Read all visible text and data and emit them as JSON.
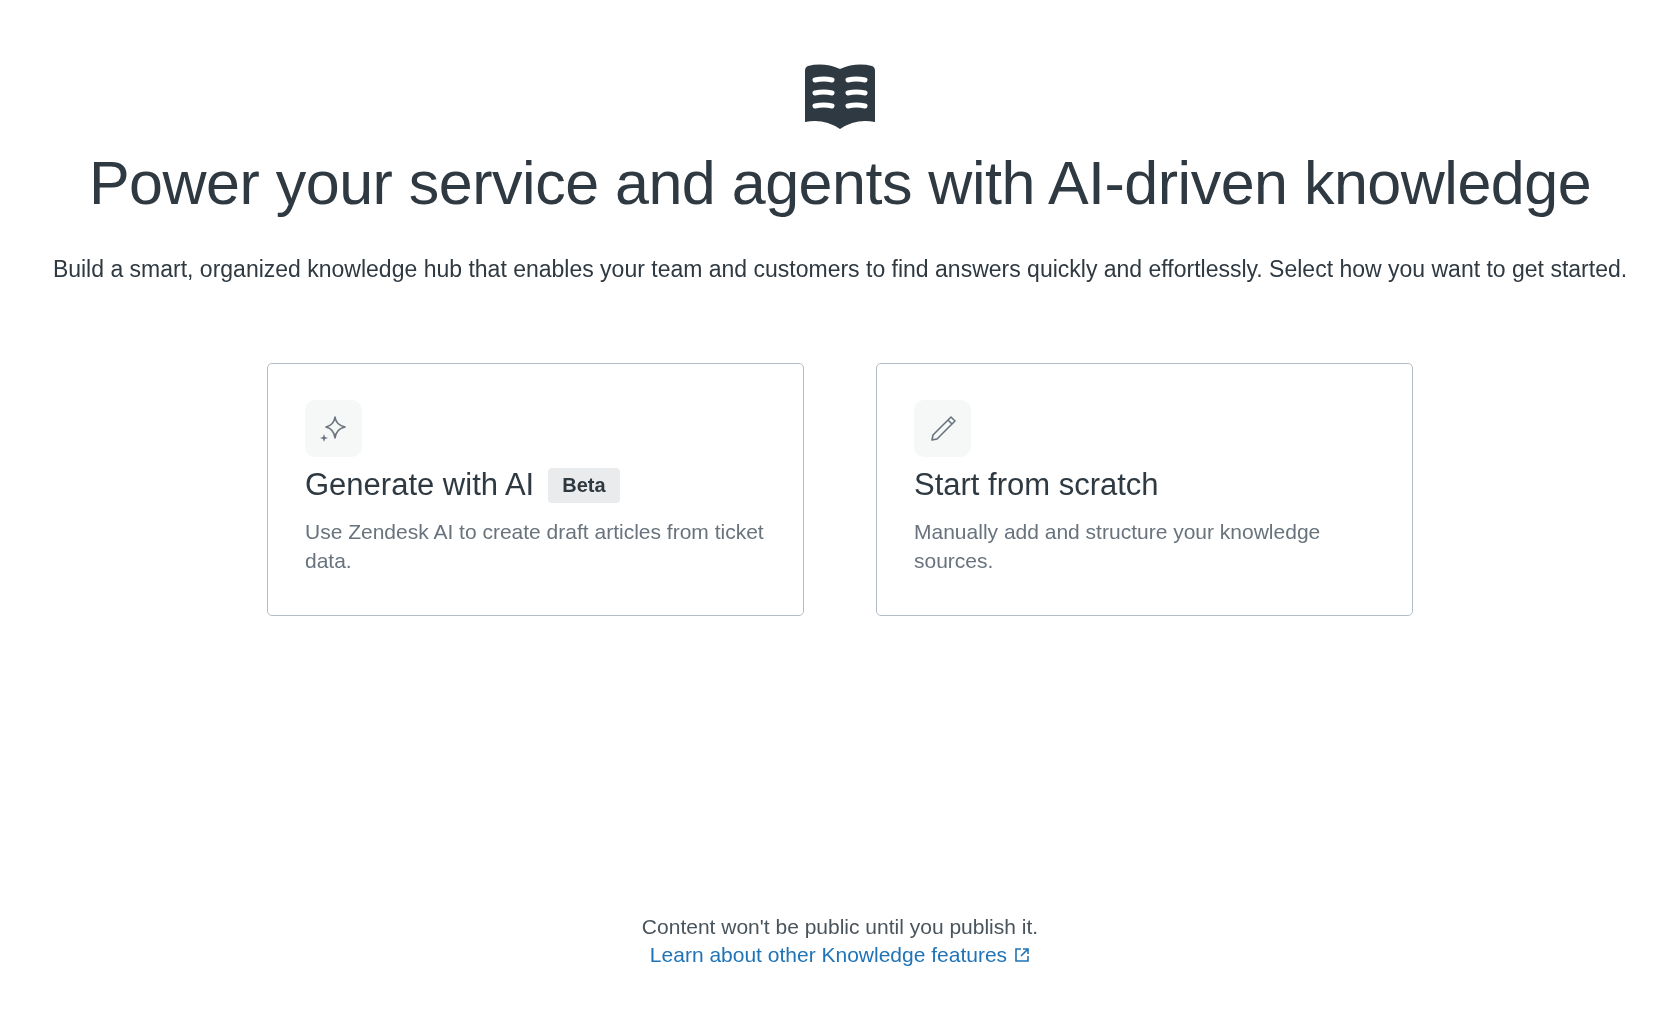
{
  "title": "Power your service and agents with AI-driven knowledge",
  "subtitle": "Build a smart, organized knowledge hub that enables your team and customers to find answers quickly and effortlessly. Select how you want to get started.",
  "options": [
    {
      "kind": "sparkle",
      "title": "Generate with AI",
      "badge": "Beta",
      "description": "Use Zendesk AI to create draft articles from ticket data."
    },
    {
      "kind": "pencil",
      "title": "Start from scratch",
      "description": "Manually add and structure your knowledge sources."
    }
  ],
  "footer": {
    "note": "Content won't be public until you publish it.",
    "link": "Learn about other Knowledge features"
  }
}
